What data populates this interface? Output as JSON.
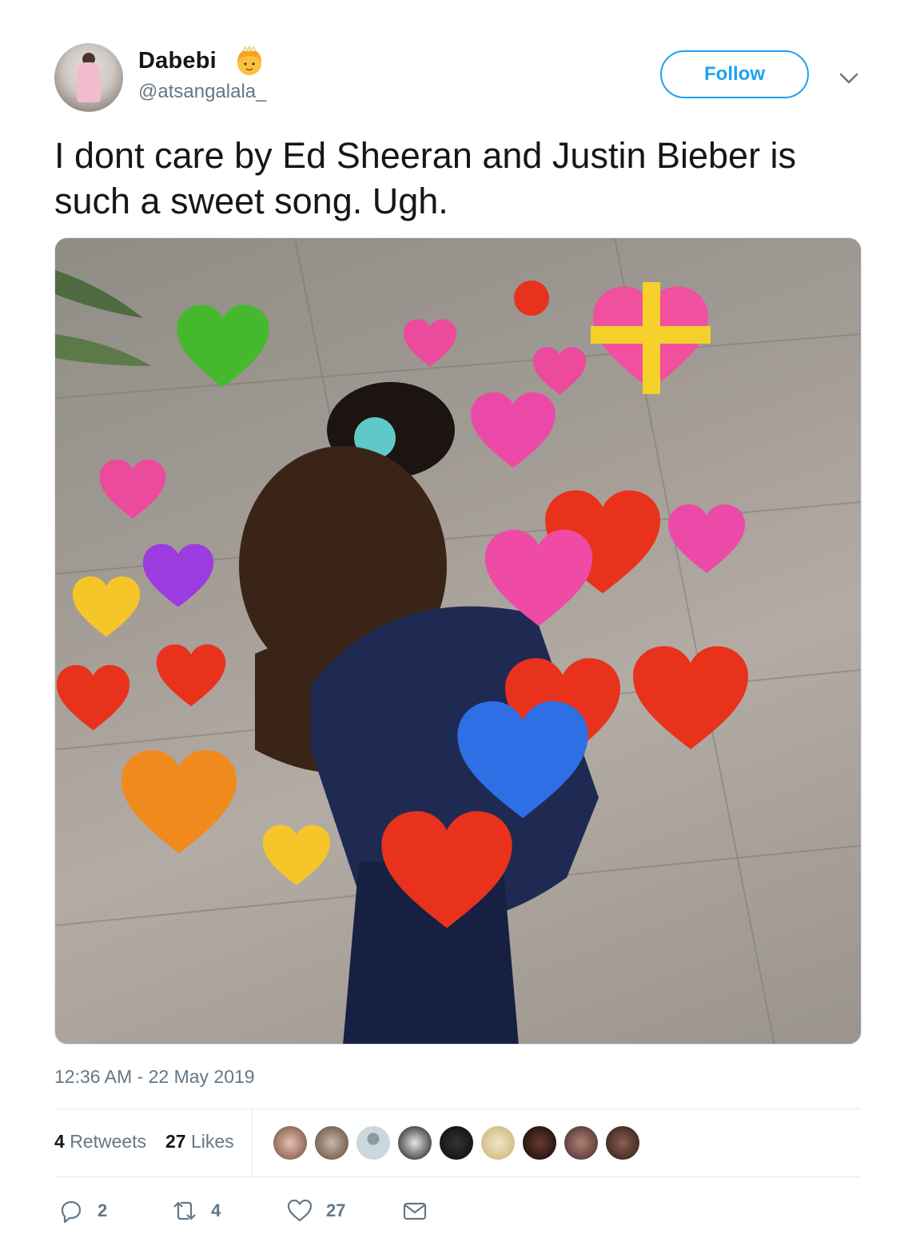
{
  "user": {
    "display_name": "Dabebi",
    "handle": "@atsangalala_",
    "badge_icon": "princess-emoji-icon"
  },
  "header": {
    "follow_label": "Follow",
    "caret_icon": "chevron-down-icon"
  },
  "tweet": {
    "text": "I dont care by Ed Sheeran and Justin Bieber is such a sweet song. Ugh.",
    "timestamp": "12:36 AM - 22 May 2019"
  },
  "stats": {
    "retweets_count": "4",
    "retweets_label": "Retweets",
    "likes_count": "27",
    "likes_label": "Likes"
  },
  "actions": {
    "reply_count": "2",
    "retweet_count": "4",
    "like_count": "27"
  },
  "colors": {
    "accent": "#1da1f2",
    "secondary_text": "#657786",
    "primary_text": "#14171a"
  }
}
